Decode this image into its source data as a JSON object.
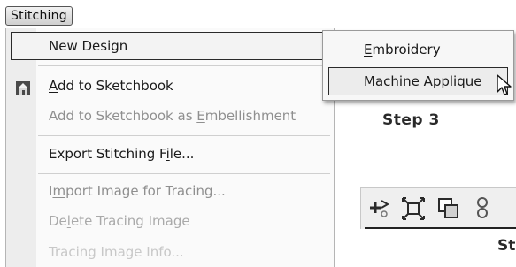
{
  "menubar": {
    "title": "Stitching"
  },
  "menu": {
    "items": [
      {
        "label": "New Design"
      },
      {
        "pre": "",
        "mn": "A",
        "post": "dd to Sketchbook",
        "icon": "sketchbook-house-icon"
      },
      {
        "pre": "Add to Sketchbook as ",
        "mn": "E",
        "post": "mbellishment"
      },
      {
        "pre": "Export Stitching F",
        "mn": "i",
        "post": "le..."
      },
      {
        "pre": "I",
        "mn": "m",
        "post": "port Image for Tracing..."
      },
      {
        "pre": "De",
        "mn": "l",
        "post": "ete Tracing Image"
      },
      {
        "label": "Tracing Image Info..."
      }
    ]
  },
  "submenu": {
    "items": [
      {
        "mn": "E",
        "post": "mbroidery"
      },
      {
        "mn": "M",
        "post": "achine Applique"
      }
    ]
  },
  "annotations": {
    "step3": "Step 3",
    "step_partial": "St"
  },
  "toolbar": {
    "icons": [
      "add-node-icon",
      "resize-arrows-icon",
      "overlap-squares-icon",
      "pattern-icon"
    ]
  }
}
